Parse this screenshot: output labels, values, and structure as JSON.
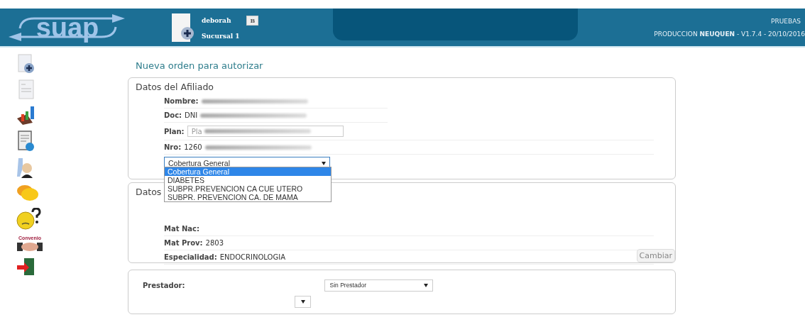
{
  "header": {
    "logo": "suap",
    "user": "deborah",
    "user_badge": "B",
    "branch": "Sucursal 1",
    "env": "PRUEBAS",
    "version": "PRODUCCION **NEUQUEN** - V1.7.4 - 20/10/2016"
  },
  "sidebar": {
    "items": [
      {
        "kind": "new-order"
      },
      {
        "kind": "list"
      },
      {
        "kind": "chart"
      },
      {
        "kind": "invoice"
      },
      {
        "kind": "doctor"
      },
      {
        "kind": "chat"
      },
      {
        "kind": "help"
      },
      {
        "kind": "agreement",
        "label": "Convenio"
      },
      {
        "kind": "exit"
      }
    ]
  },
  "page_title": "Nueva orden para autorizar",
  "affiliate": {
    "title": "Datos del Afiliado",
    "fields": [
      {
        "kind": "text",
        "label": "Nombre:",
        "redacted": true
      },
      {
        "kind": "text",
        "label": "Doc:",
        "value": "DNI",
        "redacted": true
      },
      {
        "kind": "input",
        "label": "Plan:",
        "placeholder": "Pla",
        "redacted": true
      },
      {
        "kind": "text",
        "label": "Nro:",
        "value": "1260",
        "redacted": true
      }
    ],
    "coverage": {
      "value": "Cobertura General",
      "open": true,
      "options": [
        {
          "label": "Cobertura General",
          "selected": true
        },
        {
          "label": "DIABETES",
          "selected": false
        },
        {
          "label": "SUBPR.PREVENCION CA CUE UTERO",
          "selected": false
        },
        {
          "label": "SUBPR. PREVENCION CA. DE MAMA",
          "selected": false
        }
      ]
    }
  },
  "professional": {
    "title": "Datos",
    "fields": [
      {
        "label": "Mat Nac:"
      },
      {
        "label": "Mat Prov:",
        "value": "2803"
      },
      {
        "label": "Especialidad:",
        "value": "ENDOCRINOLOGIA"
      }
    ],
    "button": "Cambiar"
  },
  "provider": {
    "label": "Prestador:",
    "select": "Sin Prestador"
  }
}
